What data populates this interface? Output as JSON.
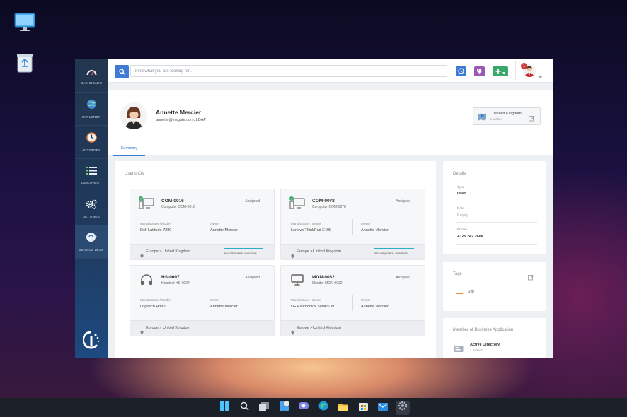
{
  "search": {
    "placeholder": "Find what you are looking for..."
  },
  "notifications": {
    "count": "1"
  },
  "sidebar": {
    "items": [
      {
        "label": "DASHBOARD",
        "icon": "gauge-icon"
      },
      {
        "label": "EXPLORER",
        "icon": "globe-icon"
      },
      {
        "label": "ACTIVITIES",
        "icon": "clock-icon"
      },
      {
        "label": "DISCOVERY",
        "icon": "list-icon"
      },
      {
        "label": "SETTINGS",
        "icon": "gears-icon"
      },
      {
        "label": "SERVICE DESK",
        "icon": "service-icon"
      }
    ]
  },
  "profile": {
    "name": "Annette Mercier",
    "email": "annette@insgate.com, LDAP",
    "location_value": "...United Kingdom",
    "location_label": "Location"
  },
  "tabs": {
    "summary": "Summary"
  },
  "cis": {
    "title": "User's CIs",
    "manufacturer_label": "Manufacturer / Model",
    "owner_label": "Owner",
    "items": [
      {
        "code": "COM-0016",
        "name": "Computer COM-0016",
        "status": "Assigned",
        "manufacturer": "Dell Latitude 7280",
        "owner": "Annette Mercier",
        "location": "Europe > United Kingdom",
        "tags": "all-computers, windows",
        "icon": "computer-icon"
      },
      {
        "code": "COM-0078",
        "name": "Computer COM-0078",
        "status": "Assigned",
        "manufacturer": "Lenovo ThinkPad E495",
        "owner": "Annette Mercier",
        "location": "Europe > United Kingdom",
        "tags": "all-computers, windows",
        "icon": "computer-icon"
      },
      {
        "code": "HS-0007",
        "name": "Headset HS-0007",
        "status": "Assigned",
        "manufacturer": "Logitech H390",
        "owner": "Annette Mercier",
        "location": "Europe > United Kingdom",
        "tags": "",
        "icon": "headset-icon"
      },
      {
        "code": "MON-0032",
        "name": "Monitor MON-0032",
        "status": "Assigned",
        "manufacturer": "LG Electronics 24MP60V...",
        "owner": "Annette Mercier",
        "location": "Europe > United Kingdom",
        "tags": "",
        "icon": "monitor-icon"
      }
    ]
  },
  "details": {
    "title": "Details",
    "type_label": "Type",
    "type_value": "User",
    "role_label": "Role",
    "role_value": "Empty",
    "phone_label": "Phone",
    "phone_value": "+325 242 2684"
  },
  "tags": {
    "title": "Tags",
    "items": [
      {
        "label": "VIP",
        "color": "#f0883a"
      }
    ]
  },
  "business_apps": {
    "title": "Member of Business Application",
    "items": [
      {
        "name": "Active Directory",
        "relation": "1 relation"
      }
    ]
  },
  "colors": {
    "accent": "#3f7bd2",
    "sidebar": "#22364e",
    "tag_bar": "#2ab0c9",
    "green": "#3aa86b",
    "purple": "#9b59b6"
  }
}
